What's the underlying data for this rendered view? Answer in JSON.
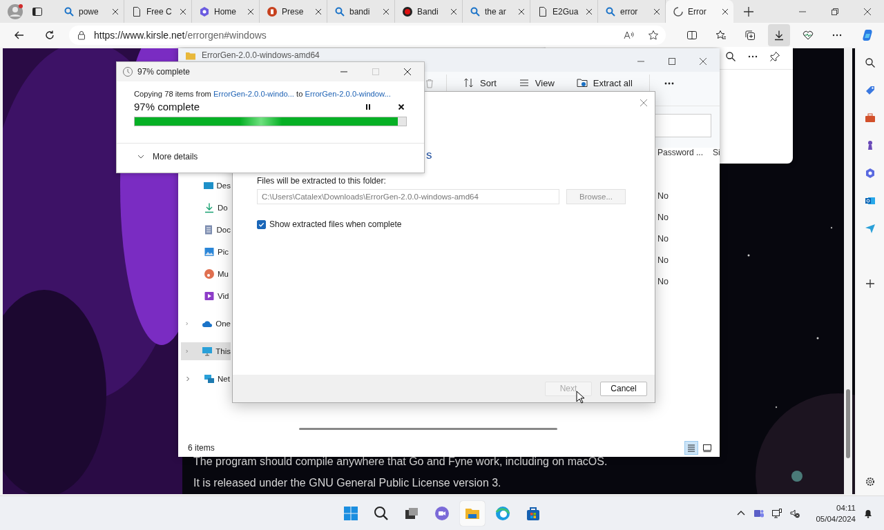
{
  "browser": {
    "tabs": [
      {
        "kind": "search",
        "label": "powe",
        "selected": false
      },
      {
        "kind": "page",
        "label": "Free C",
        "selected": false
      },
      {
        "kind": "hex",
        "label": "Home",
        "selected": false
      },
      {
        "kind": "slides",
        "label": "Prese",
        "selected": false
      },
      {
        "kind": "search",
        "label": "bandi",
        "selected": false
      },
      {
        "kind": "record",
        "label": "Bandi",
        "selected": false
      },
      {
        "kind": "search",
        "label": "the ar",
        "selected": false
      },
      {
        "kind": "page",
        "label": "E2Gua",
        "selected": false
      },
      {
        "kind": "search",
        "label": "error",
        "selected": false
      },
      {
        "kind": "loading",
        "label": "Error",
        "selected": true
      }
    ],
    "address_host": "https://www.kirsle.net",
    "address_path": "/errorgen#windows"
  },
  "explorer": {
    "title": "ErrorGen-2.0.0-windows-amd64",
    "toolbar": [
      "Sort",
      "View",
      "Extract all"
    ],
    "columns": [
      "Password ...",
      "Si"
    ],
    "rows": [
      "No",
      "No",
      "No",
      "No",
      "No"
    ],
    "nav": [
      {
        "kind": "desktop",
        "label": "Des",
        "expandable": false,
        "selected": false
      },
      {
        "kind": "download",
        "label": "Do",
        "expandable": false,
        "selected": false
      },
      {
        "kind": "documents",
        "label": "Doc",
        "expandable": false,
        "selected": false
      },
      {
        "kind": "pictures",
        "label": "Pic",
        "expandable": false,
        "selected": false
      },
      {
        "kind": "music",
        "label": "Mu",
        "expandable": false,
        "selected": false
      },
      {
        "kind": "videos",
        "label": "Vid",
        "expandable": false,
        "selected": false
      },
      {
        "kind": "cloud",
        "label": "One",
        "expandable": true,
        "selected": false
      },
      {
        "kind": "pc",
        "label": "This",
        "expandable": true,
        "selected": true
      },
      {
        "kind": "network",
        "label": "Net",
        "expandable": true,
        "selected": false
      }
    ],
    "status": "6 items",
    "views": [
      {
        "kind": "details",
        "selected": true
      },
      {
        "kind": "tiles",
        "selected": false
      }
    ]
  },
  "extract_dialog": {
    "title_fragment": "s",
    "folder_label": "Files will be extracted to this folder:",
    "path": "C:\\Users\\Catalex\\Downloads\\ErrorGen-2.0.0-windows-amd64",
    "browse": "Browse...",
    "show_files_label": "Show extracted files when complete",
    "show_files_checked": true,
    "buttons": [
      {
        "label": "Next",
        "disabled": true
      },
      {
        "label": "Cancel",
        "disabled": false
      }
    ]
  },
  "copy_dialog": {
    "title": "97% complete",
    "prefix": "Copying 78 items from",
    "source": "ErrorGen-2.0.0-windo...",
    "joiner": "to",
    "destination": "ErrorGen-2.0.0-window...",
    "status": "97% complete",
    "level": 0.97,
    "details": "More details"
  },
  "web_page": {
    "lines": [
      "The program should compile anywhere that Go and Fyne work, including on macOS.",
      "It is released under the GNU General Public License version 3."
    ]
  },
  "taskbar": {
    "time": "04:11",
    "date": "05/04/2024"
  }
}
